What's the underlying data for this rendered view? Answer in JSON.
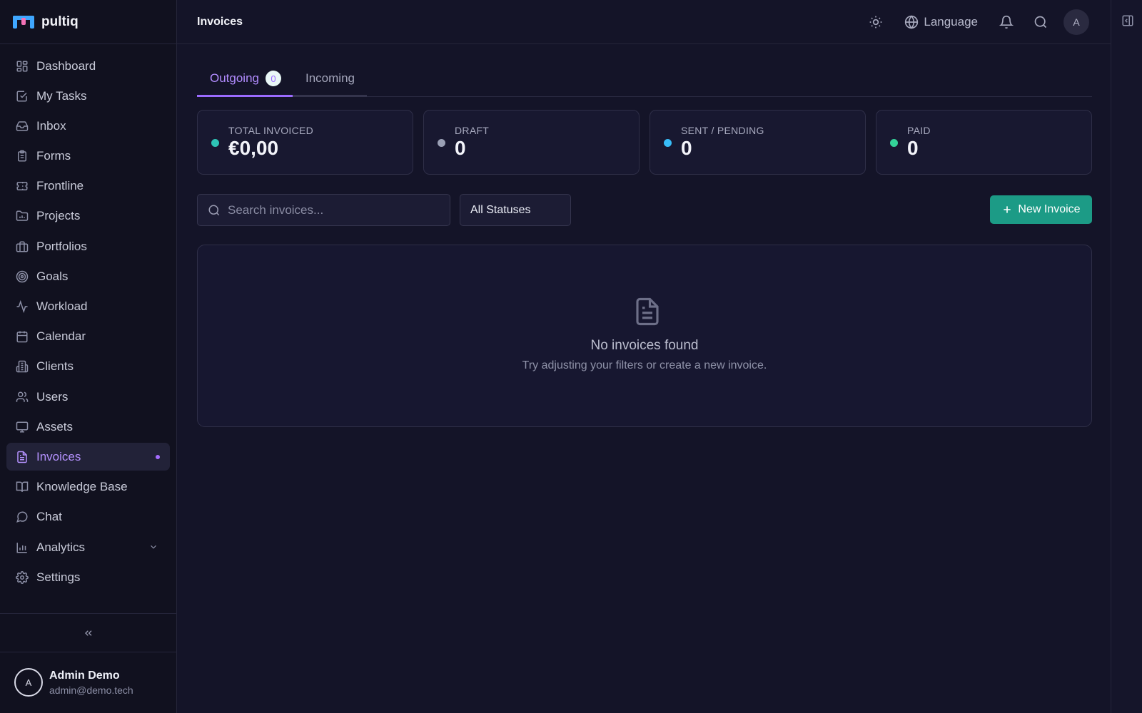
{
  "app": {
    "name": "pultiq"
  },
  "sidebar": {
    "items": [
      {
        "label": "Dashboard",
        "icon": "dashboard-icon"
      },
      {
        "label": "My Tasks",
        "icon": "check-square-icon"
      },
      {
        "label": "Inbox",
        "icon": "inbox-icon"
      },
      {
        "label": "Forms",
        "icon": "clipboard-icon"
      },
      {
        "label": "Frontline",
        "icon": "ticket-icon"
      },
      {
        "label": "Projects",
        "icon": "folder-chart-icon"
      },
      {
        "label": "Portfolios",
        "icon": "briefcase-icon"
      },
      {
        "label": "Goals",
        "icon": "target-icon"
      },
      {
        "label": "Workload",
        "icon": "activity-icon"
      },
      {
        "label": "Calendar",
        "icon": "calendar-icon"
      },
      {
        "label": "Clients",
        "icon": "building-icon"
      },
      {
        "label": "Users",
        "icon": "users-icon"
      },
      {
        "label": "Assets",
        "icon": "monitor-icon"
      },
      {
        "label": "Invoices",
        "icon": "file-text-icon",
        "active": true
      },
      {
        "label": "Knowledge Base",
        "icon": "book-icon"
      },
      {
        "label": "Chat",
        "icon": "message-circle-icon"
      },
      {
        "label": "Analytics",
        "icon": "bar-chart-icon",
        "expandable": true
      },
      {
        "label": "Settings",
        "icon": "gear-icon"
      }
    ],
    "collapse_icon": "chevrons-left-icon",
    "user": {
      "avatar_initial": "A",
      "name": "Admin Demo",
      "email": "admin@demo.tech"
    }
  },
  "header": {
    "title": "Invoices",
    "language_label": "Language",
    "avatar_initial": "A"
  },
  "tabs": [
    {
      "label": "Outgoing",
      "badge": "0",
      "active": true
    },
    {
      "label": "Incoming"
    }
  ],
  "stats": [
    {
      "label": "TOTAL INVOICED",
      "value": "€0,00",
      "color": "#2ec4b6"
    },
    {
      "label": "DRAFT",
      "value": "0",
      "color": "#9aa0b5"
    },
    {
      "label": "SENT / PENDING",
      "value": "0",
      "color": "#38bdf8"
    },
    {
      "label": "PAID",
      "value": "0",
      "color": "#34d399"
    }
  ],
  "filters": {
    "search_placeholder": "Search invoices...",
    "status_selected": "All Statuses",
    "new_button": "New Invoice"
  },
  "empty_state": {
    "title": "No invoices found",
    "subtitle": "Try adjusting your filters or create a new invoice."
  },
  "colors": {
    "accent": "#9b6bff",
    "primary_button": "#1c9b86",
    "background": "#141428",
    "sidebar": "#11111f"
  }
}
